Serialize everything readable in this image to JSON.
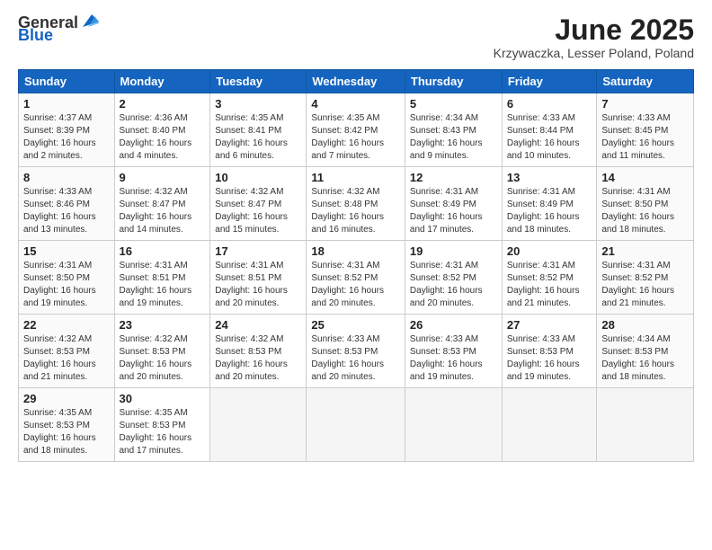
{
  "header": {
    "logo_general": "General",
    "logo_blue": "Blue",
    "month_title": "June 2025",
    "location": "Krzywaczka, Lesser Poland, Poland"
  },
  "days_of_week": [
    "Sunday",
    "Monday",
    "Tuesday",
    "Wednesday",
    "Thursday",
    "Friday",
    "Saturday"
  ],
  "weeks": [
    [
      {
        "day": 1,
        "sunrise": "4:37 AM",
        "sunset": "8:39 PM",
        "daylight": "16 hours and 2 minutes."
      },
      {
        "day": 2,
        "sunrise": "4:36 AM",
        "sunset": "8:40 PM",
        "daylight": "16 hours and 4 minutes."
      },
      {
        "day": 3,
        "sunrise": "4:35 AM",
        "sunset": "8:41 PM",
        "daylight": "16 hours and 6 minutes."
      },
      {
        "day": 4,
        "sunrise": "4:35 AM",
        "sunset": "8:42 PM",
        "daylight": "16 hours and 7 minutes."
      },
      {
        "day": 5,
        "sunrise": "4:34 AM",
        "sunset": "8:43 PM",
        "daylight": "16 hours and 9 minutes."
      },
      {
        "day": 6,
        "sunrise": "4:33 AM",
        "sunset": "8:44 PM",
        "daylight": "16 hours and 10 minutes."
      },
      {
        "day": 7,
        "sunrise": "4:33 AM",
        "sunset": "8:45 PM",
        "daylight": "16 hours and 11 minutes."
      }
    ],
    [
      {
        "day": 8,
        "sunrise": "4:33 AM",
        "sunset": "8:46 PM",
        "daylight": "16 hours and 13 minutes."
      },
      {
        "day": 9,
        "sunrise": "4:32 AM",
        "sunset": "8:47 PM",
        "daylight": "16 hours and 14 minutes."
      },
      {
        "day": 10,
        "sunrise": "4:32 AM",
        "sunset": "8:47 PM",
        "daylight": "16 hours and 15 minutes."
      },
      {
        "day": 11,
        "sunrise": "4:32 AM",
        "sunset": "8:48 PM",
        "daylight": "16 hours and 16 minutes."
      },
      {
        "day": 12,
        "sunrise": "4:31 AM",
        "sunset": "8:49 PM",
        "daylight": "16 hours and 17 minutes."
      },
      {
        "day": 13,
        "sunrise": "4:31 AM",
        "sunset": "8:49 PM",
        "daylight": "16 hours and 18 minutes."
      },
      {
        "day": 14,
        "sunrise": "4:31 AM",
        "sunset": "8:50 PM",
        "daylight": "16 hours and 18 minutes."
      }
    ],
    [
      {
        "day": 15,
        "sunrise": "4:31 AM",
        "sunset": "8:50 PM",
        "daylight": "16 hours and 19 minutes."
      },
      {
        "day": 16,
        "sunrise": "4:31 AM",
        "sunset": "8:51 PM",
        "daylight": "16 hours and 19 minutes."
      },
      {
        "day": 17,
        "sunrise": "4:31 AM",
        "sunset": "8:51 PM",
        "daylight": "16 hours and 20 minutes."
      },
      {
        "day": 18,
        "sunrise": "4:31 AM",
        "sunset": "8:52 PM",
        "daylight": "16 hours and 20 minutes."
      },
      {
        "day": 19,
        "sunrise": "4:31 AM",
        "sunset": "8:52 PM",
        "daylight": "16 hours and 20 minutes."
      },
      {
        "day": 20,
        "sunrise": "4:31 AM",
        "sunset": "8:52 PM",
        "daylight": "16 hours and 21 minutes."
      },
      {
        "day": 21,
        "sunrise": "4:31 AM",
        "sunset": "8:52 PM",
        "daylight": "16 hours and 21 minutes."
      }
    ],
    [
      {
        "day": 22,
        "sunrise": "4:32 AM",
        "sunset": "8:53 PM",
        "daylight": "16 hours and 21 minutes."
      },
      {
        "day": 23,
        "sunrise": "4:32 AM",
        "sunset": "8:53 PM",
        "daylight": "16 hours and 20 minutes."
      },
      {
        "day": 24,
        "sunrise": "4:32 AM",
        "sunset": "8:53 PM",
        "daylight": "16 hours and 20 minutes."
      },
      {
        "day": 25,
        "sunrise": "4:33 AM",
        "sunset": "8:53 PM",
        "daylight": "16 hours and 20 minutes."
      },
      {
        "day": 26,
        "sunrise": "4:33 AM",
        "sunset": "8:53 PM",
        "daylight": "16 hours and 19 minutes."
      },
      {
        "day": 27,
        "sunrise": "4:33 AM",
        "sunset": "8:53 PM",
        "daylight": "16 hours and 19 minutes."
      },
      {
        "day": 28,
        "sunrise": "4:34 AM",
        "sunset": "8:53 PM",
        "daylight": "16 hours and 18 minutes."
      }
    ],
    [
      {
        "day": 29,
        "sunrise": "4:35 AM",
        "sunset": "8:53 PM",
        "daylight": "16 hours and 18 minutes."
      },
      {
        "day": 30,
        "sunrise": "4:35 AM",
        "sunset": "8:53 PM",
        "daylight": "16 hours and 17 minutes."
      },
      null,
      null,
      null,
      null,
      null
    ]
  ]
}
